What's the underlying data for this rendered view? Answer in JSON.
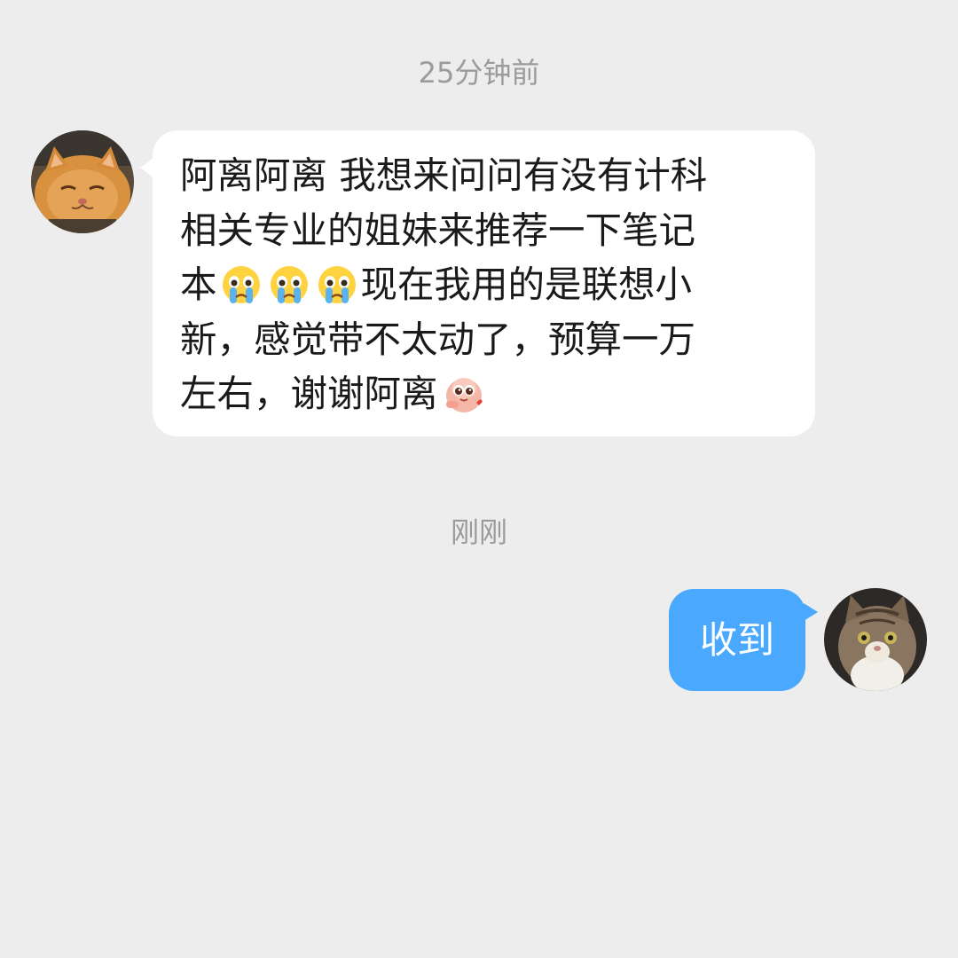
{
  "chat": {
    "timestamps": [
      "25分钟前",
      "刚刚"
    ],
    "incoming": {
      "lines": [
        "阿离阿离 我想来问问有没有计科",
        "相关专业的姐妹来推荐一下笔记",
        "现在我用的是联想小",
        "新，感觉带不太动了，预算一万",
        "左右，谢谢阿离"
      ],
      "line3_prefix": "本",
      "emojis": [
        "crying-face-emoji",
        "crying-face-emoji",
        "crying-face-emoji",
        "shy-sticker-emoji"
      ]
    },
    "outgoing": {
      "text": "收到"
    }
  },
  "colors": {
    "background": "#ededed",
    "incoming_bubble": "#ffffff",
    "outgoing_bubble": "#4aa8ff",
    "timestamp_text": "#9b9b9b"
  }
}
